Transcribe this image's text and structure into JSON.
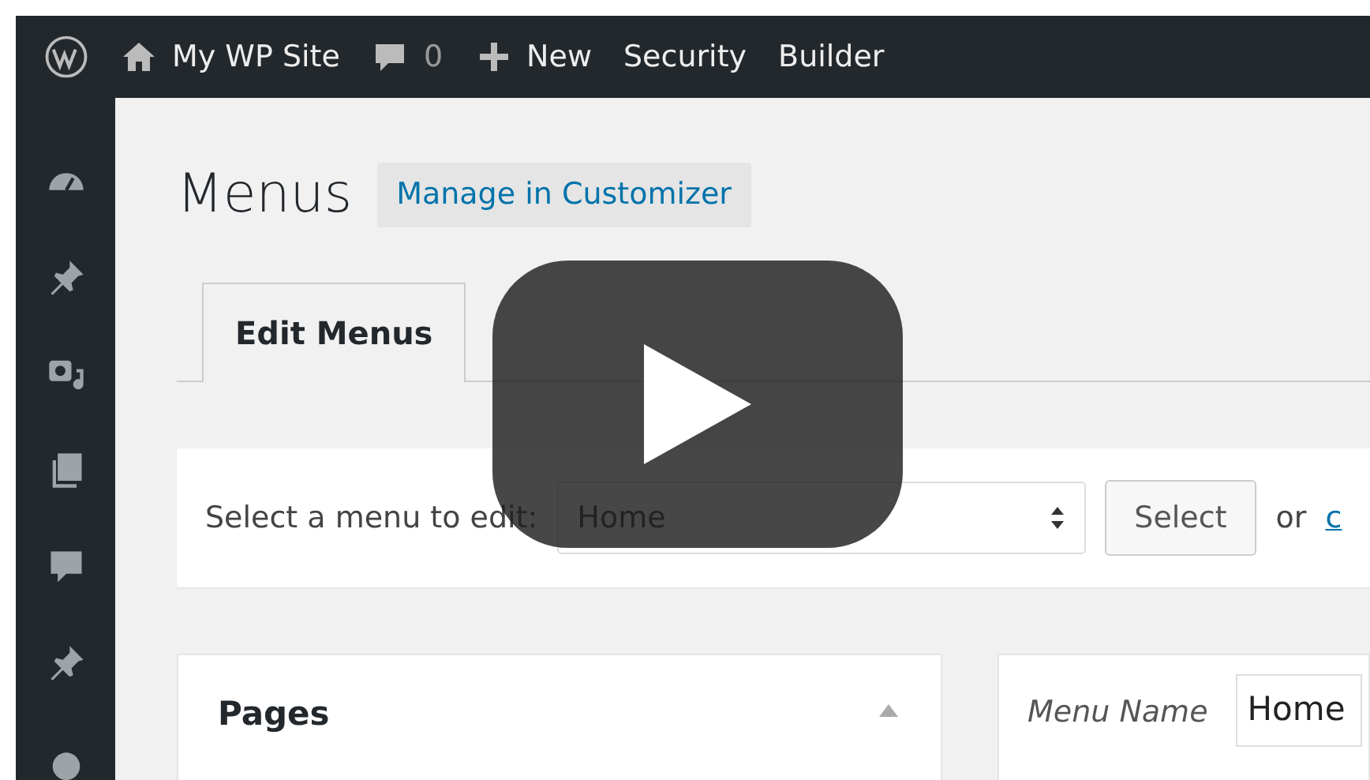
{
  "admin_bar": {
    "items": [
      {
        "kind": "logo"
      },
      {
        "kind": "home",
        "label": "My WP Site"
      },
      {
        "kind": "comments",
        "label": "0"
      },
      {
        "kind": "new",
        "label": "New"
      },
      {
        "kind": "text",
        "label": "Security"
      },
      {
        "kind": "text",
        "label": "Builder"
      }
    ]
  },
  "sidebar": {
    "items": [
      {
        "kind": "dashboard"
      },
      {
        "kind": "pin"
      },
      {
        "kind": "media"
      },
      {
        "kind": "pages"
      },
      {
        "kind": "comments"
      },
      {
        "kind": "pin"
      },
      {
        "kind": "circle"
      }
    ]
  },
  "page": {
    "title": "Menus",
    "action": "Manage in Customizer"
  },
  "tabs": [
    {
      "label": "Edit Menus",
      "selected": true
    }
  ],
  "menu_select": {
    "label": "Select a menu to edit:",
    "value": "Home",
    "button": "Select",
    "or_text": "or",
    "link": "c"
  },
  "pages_panel": {
    "title": "Pages",
    "expanded": true
  },
  "menu_name": {
    "label": "Menu Name",
    "value": "Home"
  }
}
